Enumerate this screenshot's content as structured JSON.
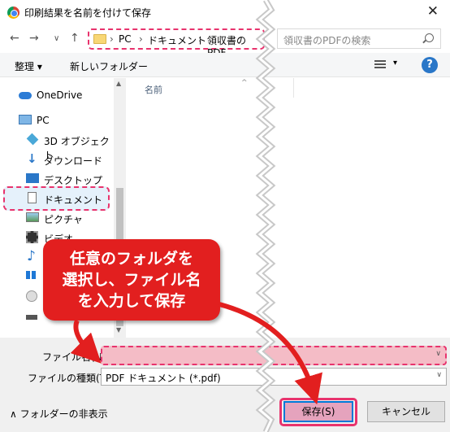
{
  "window": {
    "title": "印刷結果を名前を付けて保存",
    "close_glyph": "✕"
  },
  "nav": {
    "back": "←",
    "forward": "→",
    "recent": "∨",
    "up": "↑"
  },
  "address": {
    "crumbs": [
      "PC",
      "ドキュメント",
      "領収書のPDF"
    ],
    "sep": "›"
  },
  "search": {
    "placeholder": "領収書のPDFの検索",
    "icon": "search-icon"
  },
  "toolbar": {
    "organize": "整理 ▾",
    "new_folder": "新しいフォルダー",
    "view_caret": "▾",
    "help": "?"
  },
  "sidebar": {
    "items": [
      {
        "label": "OneDrive",
        "icon": "cloud-icon"
      },
      {
        "label": "PC",
        "icon": "pc-icon"
      },
      {
        "label": "3D オブジェクト",
        "icon": "cube-icon"
      },
      {
        "label": "ダウンロード",
        "icon": "download-icon"
      },
      {
        "label": "デスクトップ",
        "icon": "desktop-icon"
      },
      {
        "label": "ドキュメント",
        "icon": "document-icon"
      },
      {
        "label": "ピクチャ",
        "icon": "picture-icon"
      },
      {
        "label": "ビデオ",
        "icon": "video-icon"
      },
      {
        "label": "",
        "icon": "music-icon"
      },
      {
        "label": "",
        "icon": "windows-icon"
      },
      {
        "label": "",
        "icon": "disk-icon"
      },
      {
        "label": "",
        "icon": "drive-icon"
      }
    ]
  },
  "file_list": {
    "name_header": "名前",
    "sort_caret": "^"
  },
  "form": {
    "filename_label": "ファイル名(N):",
    "filename_value": "",
    "filetype_label": "ファイルの種類(T):",
    "filetype_value": "PDF ドキュメント (*.pdf)",
    "dropdown_caret": "∨"
  },
  "footer": {
    "hide_folders": "∧  フォルダーの非表示",
    "save": "保存(S)",
    "cancel": "キャンセル"
  },
  "callout": {
    "line1": "任意のフォルダを",
    "line2": "選択し、ファイル名",
    "line3": "を入力して保存"
  },
  "colors": {
    "highlight": "#e8336d",
    "callout": "#e21f1f",
    "accent": "#0078d7"
  }
}
